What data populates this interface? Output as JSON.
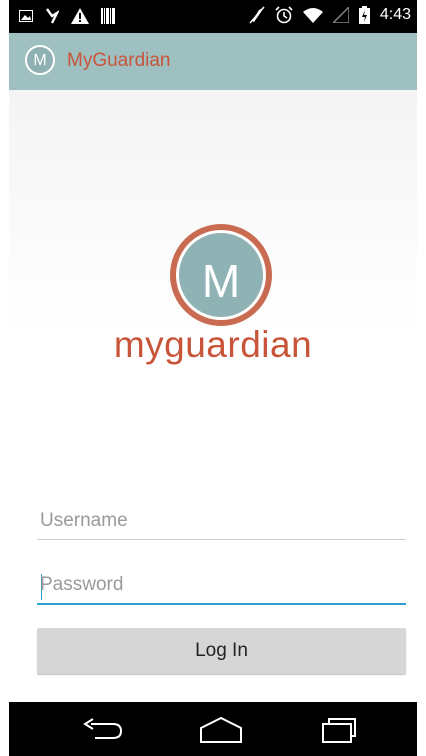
{
  "status_bar": {
    "time": "4:43",
    "left_icons": [
      "image-icon",
      "signal-icon",
      "warning-icon",
      "barcode-icon"
    ],
    "right_icons": [
      "mute-icon",
      "alarm-icon",
      "wifi-icon",
      "signal-strength-icon",
      "battery-icon"
    ]
  },
  "app_bar": {
    "icon_letter": "M",
    "title": "MyGuardian",
    "background": "#9fc0c1",
    "title_color": "#c8553a"
  },
  "logo": {
    "letter": "M",
    "wordmark": "myguardian",
    "ring_color": "#c86b50",
    "fill_color": "#8fb2b4"
  },
  "form": {
    "username_placeholder": "Username",
    "password_placeholder": "Password",
    "login_label": "Log In",
    "focus_color": "#2e9fd1"
  },
  "nav_bar": {
    "buttons": [
      "back-icon",
      "home-icon",
      "recents-icon"
    ]
  }
}
